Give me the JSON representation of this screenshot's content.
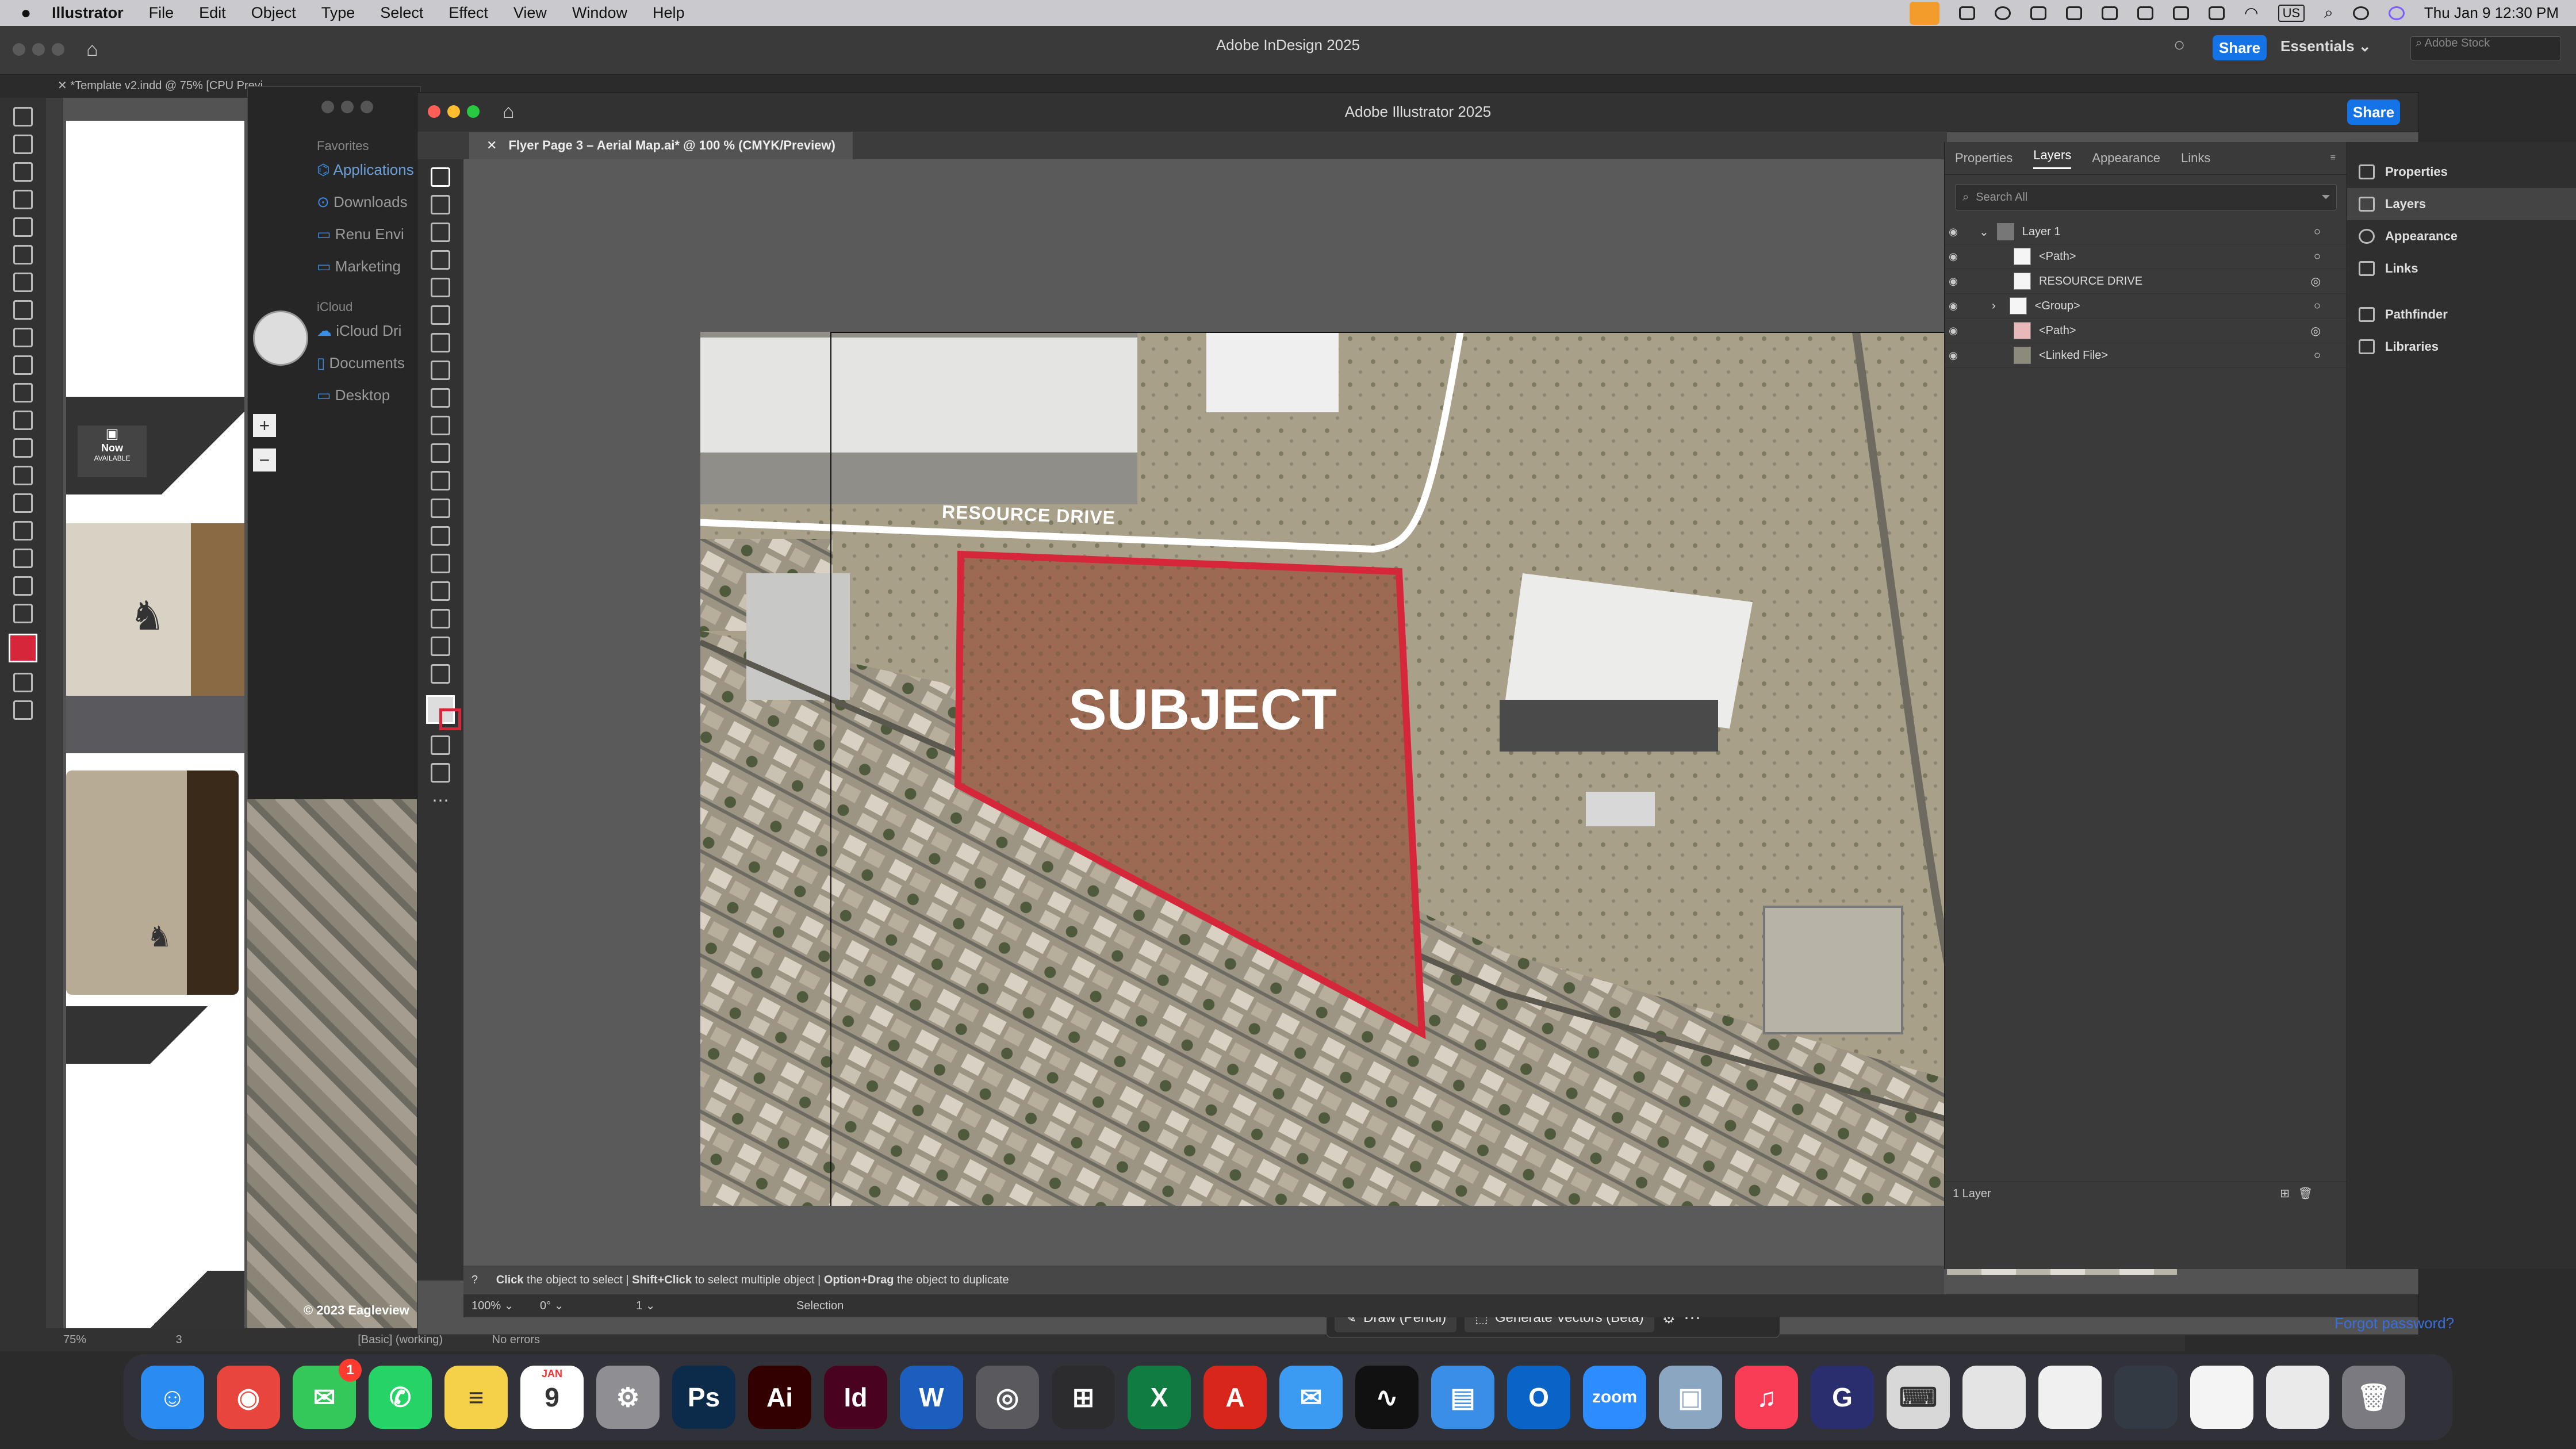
{
  "menubar": {
    "app_name": "Illustrator",
    "items": [
      "File",
      "Edit",
      "Object",
      "Type",
      "Select",
      "Effect",
      "View",
      "Window",
      "Help"
    ],
    "clock": "Thu Jan 9  12:30 PM",
    "input_source": "US"
  },
  "indesign": {
    "title": "Adobe InDesign 2025",
    "share_label": "Share",
    "workspace": "Essentials",
    "stock_search_placeholder": "Adobe Stock",
    "doc_tab": "*Template v2.indd @ 75% [CPU Previ",
    "zoom": "75%",
    "page": "3",
    "preflight_profile": "[Basic] (working)",
    "preflight_status": "No errors",
    "page_badge_line1": "Now",
    "page_badge_line2": "AVAILABLE"
  },
  "finder": {
    "favorites_label": "Favorites",
    "favorites": [
      "Applications",
      "Downloads",
      "Renu Envi",
      "Marketing"
    ],
    "icloud_label": "iCloud",
    "icloud": [
      "iCloud Dri",
      "Documents",
      "Desktop"
    ]
  },
  "illustrator": {
    "title": "Adobe Illustrator 2025",
    "share_label": "Share",
    "doc_tab": "Flyer Page 3 – Aerial Map.ai* @ 100 % (CMYK/Preview)",
    "map_labels": {
      "road": "RESOURCE DRIVE",
      "subject": "SUBJECT",
      "copyright": "© 2023 Eagleview"
    },
    "context_bar": {
      "draw": "Draw (Pencil)",
      "generate": "Generate Vectors (Beta)"
    },
    "hint": {
      "p1_bold": "Click",
      "p1": " the object to select  |  ",
      "p2_bold": "Shift+Click",
      "p2": " to select multiple object  |  ",
      "p3_bold": "Option+Drag",
      "p3": " the object to duplicate"
    },
    "status": {
      "zoom": "100%",
      "rotation": "0°",
      "artboard": "1",
      "tool": "Selection"
    }
  },
  "layers_panel": {
    "tabs": [
      "Properties",
      "Layers",
      "Appearance",
      "Links"
    ],
    "active_tab": "Layers",
    "search_placeholder": "Search All",
    "rows": [
      {
        "name": "Layer 1"
      },
      {
        "name": "<Path>"
      },
      {
        "name": "RESOURCE DRIVE"
      },
      {
        "name": "<Group>"
      },
      {
        "name": "<Path>"
      },
      {
        "name": "<Linked File>"
      }
    ],
    "footer": "1 Layer"
  },
  "right_dock": {
    "items": [
      "Properties",
      "Layers",
      "Appearance",
      "Links",
      "Pathfinder",
      "Libraries"
    ]
  },
  "login_link": "Forgot password?",
  "dock": {
    "apps": [
      {
        "name": "Finder",
        "glyph": "☺",
        "color": "#2a8cf0"
      },
      {
        "name": "Chrome",
        "glyph": "◉",
        "color": "#e8453c"
      },
      {
        "name": "Messages",
        "glyph": "✉",
        "color": "#34c759",
        "badge": "1"
      },
      {
        "name": "WhatsApp",
        "glyph": "✆",
        "color": "#25d366"
      },
      {
        "name": "Notes",
        "glyph": "≡",
        "color": "#f5d14a"
      },
      {
        "name": "Calendar",
        "glyph": "9",
        "color": "#ffffff",
        "month": "JAN"
      },
      {
        "name": "System Settings",
        "glyph": "⚙",
        "color": "#8e8e93"
      },
      {
        "name": "Photoshop",
        "glyph": "Ps",
        "color": "#0c2a4a"
      },
      {
        "name": "Illustrator",
        "glyph": "Ai",
        "color": "#330000"
      },
      {
        "name": "InDesign",
        "glyph": "Id",
        "color": "#49021f"
      },
      {
        "name": "Word",
        "glyph": "W",
        "color": "#1b5ebe"
      },
      {
        "name": "Screenshot",
        "glyph": "◎",
        "color": "#5a5a5e"
      },
      {
        "name": "Calculator",
        "glyph": "⊞",
        "color": "#2c2c2e"
      },
      {
        "name": "Excel",
        "glyph": "X",
        "color": "#107c41"
      },
      {
        "name": "Acrobat",
        "glyph": "A",
        "color": "#d8261c"
      },
      {
        "name": "Mail",
        "glyph": "✉",
        "color": "#3b9bf2"
      },
      {
        "name": "Activity Monitor",
        "glyph": "∿",
        "color": "#111111"
      },
      {
        "name": "Files",
        "glyph": "▤",
        "color": "#3a8ee6"
      },
      {
        "name": "Outlook",
        "glyph": "O",
        "color": "#0a64c8"
      },
      {
        "name": "Zoom",
        "glyph": "zoom",
        "color": "#2d8cff"
      },
      {
        "name": "Preview",
        "glyph": "▣",
        "color": "#8aa6c0"
      },
      {
        "name": "Music",
        "glyph": "♫",
        "color": "#fa3d56"
      },
      {
        "name": "Grammarly",
        "glyph": "G",
        "color": "#2b2e6e"
      },
      {
        "name": "Keyboard",
        "glyph": "⌨",
        "color": "#d8d8d8"
      },
      {
        "name": "Window 1",
        "glyph": "",
        "color": "#e4e4e4"
      },
      {
        "name": "Window 2",
        "glyph": "",
        "color": "#f0f0f0"
      },
      {
        "name": "Window 3",
        "glyph": "",
        "color": "#333a44"
      },
      {
        "name": "Window 4",
        "glyph": "",
        "color": "#f4f4f4"
      },
      {
        "name": "Window 5",
        "glyph": "",
        "color": "#eaeaea"
      },
      {
        "name": "Trash",
        "glyph": "🗑",
        "color": "#7a7a80"
      }
    ]
  },
  "colors": {
    "accent_blue": "#1473e6",
    "subject_outline": "#d6263a"
  }
}
